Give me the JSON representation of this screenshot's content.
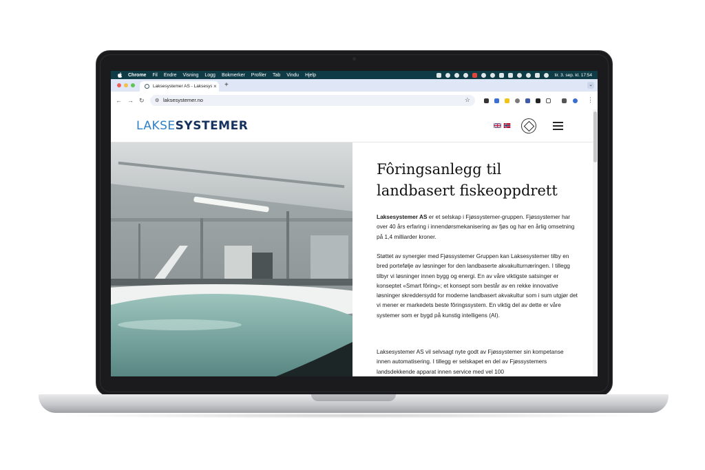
{
  "menubar": {
    "items": [
      "Chrome",
      "Fil",
      "Endre",
      "Visning",
      "Logg",
      "Bokmerker",
      "Profiler",
      "Tab",
      "Vindu",
      "Hjelp"
    ],
    "clock": "tir. 3. sep. kl. 17:54"
  },
  "browser": {
    "tab_title": "Laksesystemer AS - Laksesys",
    "tab_close": "×",
    "new_tab": "+",
    "url": "laksesystemer.no"
  },
  "site": {
    "logo_part1": "LAKSE",
    "logo_part2": "SYSTEMER",
    "flags": [
      "uk-flag-icon",
      "norway-flag-icon"
    ],
    "headline_line1": "Fôringsanlegg til",
    "headline_line2": "landbasert fiskeoppdrett",
    "intro_bold": "Laksesystemer AS",
    "intro_rest": " er et selskap i Fjøssystemer-gruppen. Fjøssystemer har over 40 års erfaring i innendørsmekanisering av fjøs og har en årlig omsetning på 1,4 milliarder kroner.",
    "paragraph2": "Støttet av synergier med Fjøssystemer Gruppen kan Laksesystemer tilby en bred portefølje av løsninger for den landbaserte akvakulturnæringen. I tillegg tilbyr vi løsninger innen bygg og energi. En av våre viktigste satsinger er konseptet «Smart fôring»; et konsept som består av en rekke innovative løsninger skreddersydd for moderne landbasert akvakultur som i sum utgjør det vi mener er markedets beste fôringssystem. En viktig del av dette er våre systemer som er bygd på kunstig intelligens (AI).",
    "paragraph3": "Laksesystemer AS vil selvsagt nyte godt av Fjøssystemer sin kompetanse innen automatisering. I tillegg er selskapet en del av Fjøssystemers landsdekkende apparat innen service med vel 100"
  }
}
